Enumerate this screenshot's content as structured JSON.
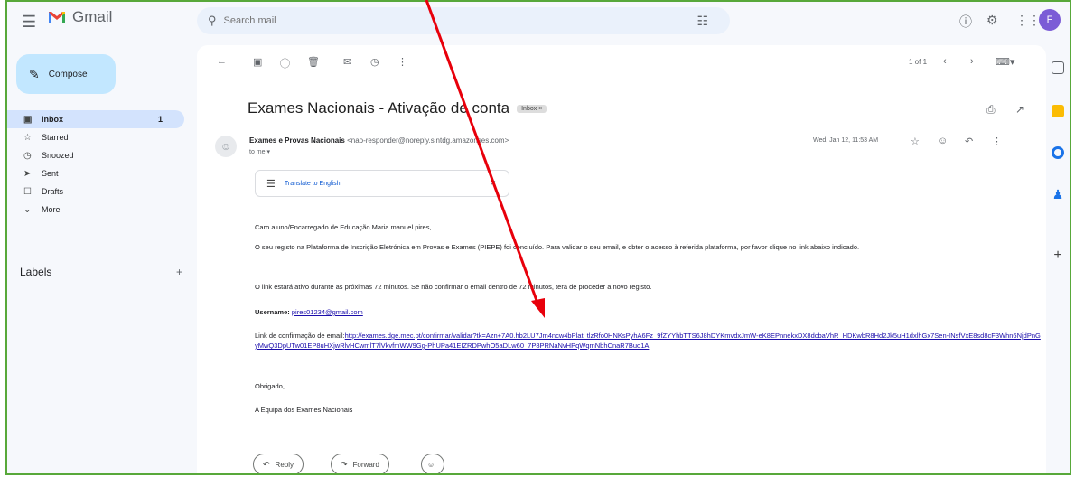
{
  "app": {
    "name": "Gmail"
  },
  "search": {
    "placeholder": "Search mail"
  },
  "compose": {
    "label": "Compose"
  },
  "nav": [
    {
      "label": "Inbox",
      "count": "1",
      "icon": "inbox-icon"
    },
    {
      "label": "Starred",
      "icon": "star-icon"
    },
    {
      "label": "Snoozed",
      "icon": "clock-icon"
    },
    {
      "label": "Sent",
      "icon": "send-icon"
    },
    {
      "label": "Drafts",
      "icon": "draft-icon"
    },
    {
      "label": "More",
      "icon": "chevron-down-icon"
    }
  ],
  "labels_header": "Labels",
  "toolbar": {
    "pagination": "1 of 1"
  },
  "email": {
    "subject": "Exames Nacionais - Ativação de conta",
    "tag": "Inbox ×",
    "sender_name": "Exames e Provas Nacionais",
    "sender_address": "<nao-responder@noreply.sintdg.amazonses.com>",
    "to": "to me ▾",
    "date": "Wed, Jan 12, 11:53 AM",
    "translate": "Translate to English",
    "greeting": "Caro aluno/Encarregado de Educação Maria manuel pires,",
    "p1": "O seu registo na Plataforma de Inscrição Eletrónica em Provas e Exames (PIEPE) foi concluído. Para validar o seu email, e obter o acesso à referida plataforma, por favor clique no link abaixo indicado.",
    "p2": "O link estará ativo durante as próximas 72 minutos. Se não confirmar o email dentro de 72 minutos, terá de proceder a novo registo.",
    "user_label": "Username:",
    "user_value": "pires01234@gmail.com",
    "link_label": "Link de confirmação de email:",
    "link_url": "http://exames.dge.mec.pt/confirmar/validar?tk=Azn+7A0.hb2LU7Jm4ncw4bPlat_tlzRfo0HNKsPyhA6Fz_9fZYYhbTTS6J8hDYKmvdxJmW-eK8EPnnekxDX8dcbaVhR_HDKwbR8Hd2Jk5uH1dxlhGx7Sen-INsfVxE8sd8cF3Whn6NjdPnGyMwQ3DpUTw01EP8uHXjwRlvHCwmlT7lVkvfmWW9Gg-PhUPa41EIZRDPwhO5aDLw60_7P8PRNaNvHPqWqmNbhCnaR7Buo1A",
    "thanks": "Obrigado,",
    "signature": "A Equipa dos Exames Nacionais",
    "reply": "Reply",
    "forward": "Forward"
  },
  "colors": {
    "frame": "#58a83a",
    "annotation_arrow": "#e8000b",
    "compose_bg": "#c2e7ff",
    "nav_active": "#d3e3fd"
  }
}
